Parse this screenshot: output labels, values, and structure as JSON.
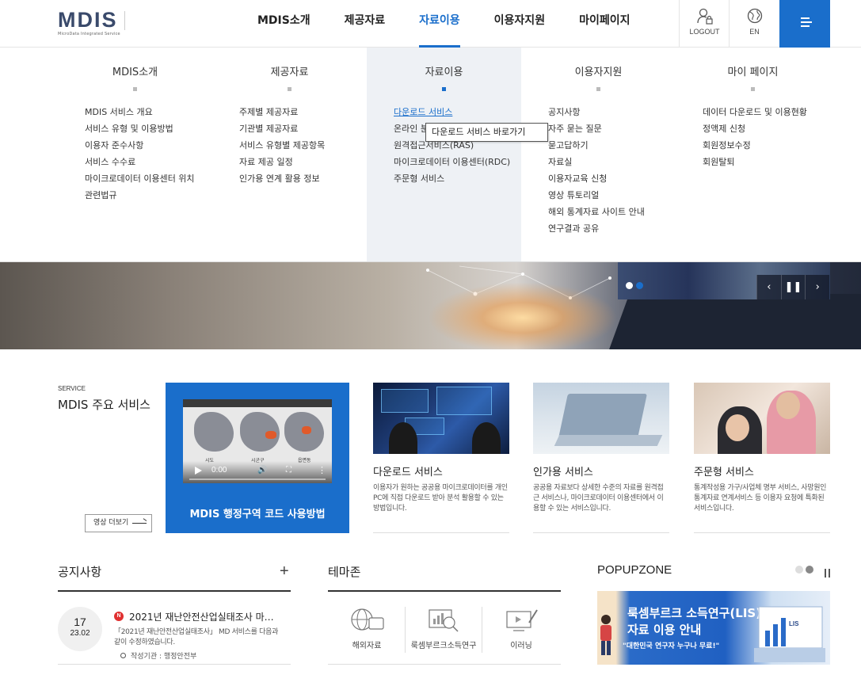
{
  "header": {
    "logo_text": "MDIS",
    "logo_sub": "MicroData Integrated Service",
    "nav": [
      "MDIS소개",
      "제공자료",
      "자료이용",
      "이용자지원",
      "마이페이지"
    ],
    "active_nav": "자료이용",
    "logout_label": "LOGOUT",
    "lang_label": "EN"
  },
  "mega_menu": {
    "columns": [
      {
        "title": "MDIS소개",
        "items": [
          "MDIS 서비스 개요",
          "서비스 유형 및 이용방법",
          "이용자 준수사항",
          "서비스 수수료",
          "마이크로데이터 이용센터 위치",
          "관련법규"
        ]
      },
      {
        "title": "제공자료",
        "items": [
          "주제별 제공자료",
          "기관별 제공자료",
          "서비스 유형별 제공항목",
          "자료 제공 일정",
          "인가용 연계 활용 정보"
        ]
      },
      {
        "title": "자료이용",
        "items": [
          "다운로드 서비스",
          "온라인 분석",
          "원격접근서비스(RAS)",
          "마이크로데이터 이용센터(RDC)",
          "주문형 서비스"
        ]
      },
      {
        "title": "이용자지원",
        "items": [
          "공지사항",
          "자주 묻는 질문",
          "묻고답하기",
          "자료실",
          "이용자교육 신청",
          "영상 튜토리얼",
          "해외 통계자료 사이트 안내",
          "연구결과 공유"
        ]
      },
      {
        "title": "마이 페이지",
        "items": [
          "데이터 다운로드 및 이용현황",
          "정액제 신청",
          "회원정보수정",
          "회원탈퇴"
        ]
      }
    ],
    "tooltip": "다운로드 서비스 바로가기"
  },
  "service": {
    "label": "SERVICE",
    "title": "MDIS 주요 서비스",
    "video_more": "영상 더보기",
    "video_time": "0:00",
    "video_regions": [
      "시도",
      "시군구",
      "읍면동"
    ],
    "feature_title": "MDIS 행정구역 코드 사용방법",
    "cards": [
      {
        "title": "다운로드 서비스",
        "desc": "이용자가 원하는 공공용 마이크로데이터를 개인 PC에 직접 다운로드 받아 분석 활용할 수 있는 방법입니다."
      },
      {
        "title": "인가용 서비스",
        "desc": "공공용 자료보다 상세한 수준의 자료를 원격접근 서비스나, 마이크로데이터 이용센터에서 이용할 수 있는 서비스입니다."
      },
      {
        "title": "주문형 서비스",
        "desc": "통계작성용 가구/사업체 명부 서비스, 사망원인통계자료 연계서비스 등 이용자 요청에 특화된 서비스입니다."
      }
    ]
  },
  "notice": {
    "title": "공지사항",
    "day": "17",
    "month": "23.02",
    "badge": "N",
    "item_title": "2021년 재난안전산업실태조사 마…",
    "item_desc": "「2021년 재난안전산업실태조사」 MD 서비스를 다음과 같이 수정하였습니다.",
    "org": "작성기관 : 행정안전부"
  },
  "themezone": {
    "title": "테마존",
    "items": [
      "해외자료",
      "룩셈부르크소득연구",
      "이러닝"
    ]
  },
  "popupzone": {
    "title": "POPUPZONE",
    "banner_title_1": "룩셈부르크 소득연구(LIS)",
    "banner_title_2": "자료 이용 안내",
    "banner_sub": "\"대한민국 연구자 누구나 무료!\"",
    "banner_side": "LIS"
  },
  "colors": {
    "accent": "#1a6ecb",
    "notice_badge": "#e03030"
  }
}
